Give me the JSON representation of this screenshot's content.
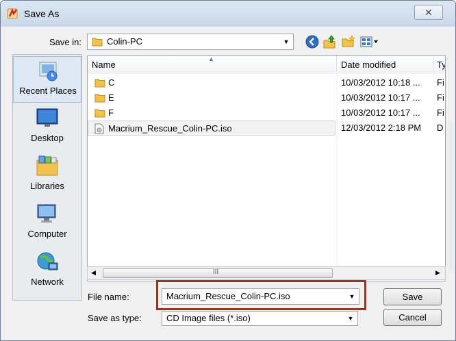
{
  "window": {
    "title": "Save As",
    "close_glyph": "✕"
  },
  "toolbar": {
    "save_in_label": "Save in:",
    "save_in_value": "Colin-PC"
  },
  "places": [
    {
      "label": "Recent Places",
      "icon": "recent-places-icon"
    },
    {
      "label": "Desktop",
      "icon": "desktop-icon"
    },
    {
      "label": "Libraries",
      "icon": "libraries-icon"
    },
    {
      "label": "Computer",
      "icon": "computer-icon"
    },
    {
      "label": "Network",
      "icon": "network-icon"
    }
  ],
  "list": {
    "columns": [
      "Name",
      "Date modified",
      "Ty"
    ],
    "rows": [
      {
        "name": "C",
        "date": "10/03/2012 10:18 ...",
        "type": "Fi",
        "icon": "folder-icon"
      },
      {
        "name": "E",
        "date": "10/03/2012 10:17 ...",
        "type": "Fi",
        "icon": "folder-icon"
      },
      {
        "name": "F",
        "date": "10/03/2012 10:17 ...",
        "type": "Fi",
        "icon": "folder-icon"
      },
      {
        "name": "Macrium_Rescue_Colin-PC.iso",
        "date": "12/03/2012 2:18 PM",
        "type": "D",
        "icon": "iso-file-icon"
      }
    ],
    "scroll_grip": "III"
  },
  "form": {
    "file_name_label": "File name:",
    "file_name_value": "Macrium_Rescue_Colin-PC.iso",
    "save_type_label": "Save as type:",
    "save_type_value": "CD Image files (*.iso)"
  },
  "buttons": {
    "save": "Save",
    "cancel": "Cancel"
  }
}
